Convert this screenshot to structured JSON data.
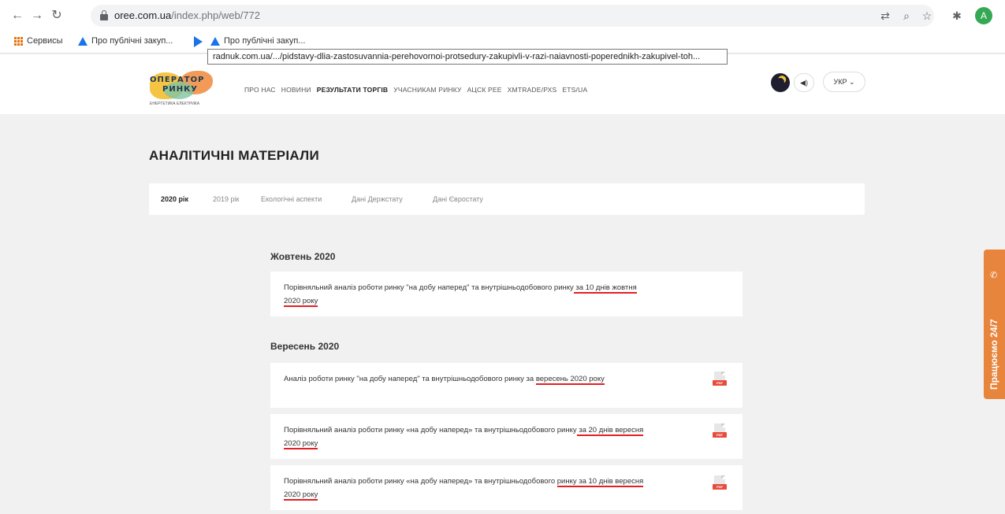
{
  "browser": {
    "url_domain": "oree.com.ua",
    "url_path": "/index.php/web/772",
    "profile_initial": "A",
    "bookmarks": [
      "Сервисы",
      "Про публічні закуп...",
      "Про публічні закуп..."
    ],
    "link_tooltip": "radnuk.com.ua/.../pidstavy-dlia-zastosuvannia-perehovornoi-protsedury-zakupivli-v-razi-naiavnosti-poperednikh-zakupivel-toh..."
  },
  "site": {
    "logo": {
      "line1": "ОПЕРАТОР",
      "line2": "РИНКУ",
      "subtitle": "ЕНЕРГЕТИКА ЕЛЕКТРИКА"
    },
    "nav": [
      "ПРО НАС",
      "НОВИНИ",
      "РЕЗУЛЬТАТИ ТОРГІВ",
      "УЧАСНИКАМ РИНКУ",
      "АЦСК РЕЕ",
      "XMTRADE/РХS",
      "ETS/UA"
    ],
    "lang": "УКР ⌄"
  },
  "page": {
    "title": "АНАЛІТИЧНІ МАТЕРІАЛИ",
    "tabs": [
      "2020 рік",
      "2019 рік",
      "Екологічні аспекти",
      "Дані Держстату",
      "Дані Євростату"
    ],
    "sections": [
      {
        "title": "Жовтень 2020",
        "items": [
          {
            "text": "Порівняльний аналіз роботи ринку \"на добу наперед\" та внутрішньодобового ринку",
            "underlined": " за 10 днів жовтня 2020 року"
          }
        ]
      },
      {
        "title": "Вересень 2020",
        "items": [
          {
            "text": "Аналіз роботи ринку \"на добу наперед\" та внутрішньодобового ринку за ",
            "underlined": "вересень 2020 року"
          },
          {
            "text": "Порівняльний аналіз роботи ринку «на добу наперед» та внутрішньодобового ринку",
            "underlined": " за 20 днів вересня 2020 року"
          },
          {
            "text": "Порівняльний аналіз роботи ринку «на добу наперед» та внутрішньодобового ",
            "underlined": "ринку за 10 днів вересня 2020 року"
          }
        ]
      }
    ],
    "pdf_label": "PDF"
  },
  "side_tab": {
    "label": "Працюємо 24/7",
    "icon": "phone-icon"
  }
}
